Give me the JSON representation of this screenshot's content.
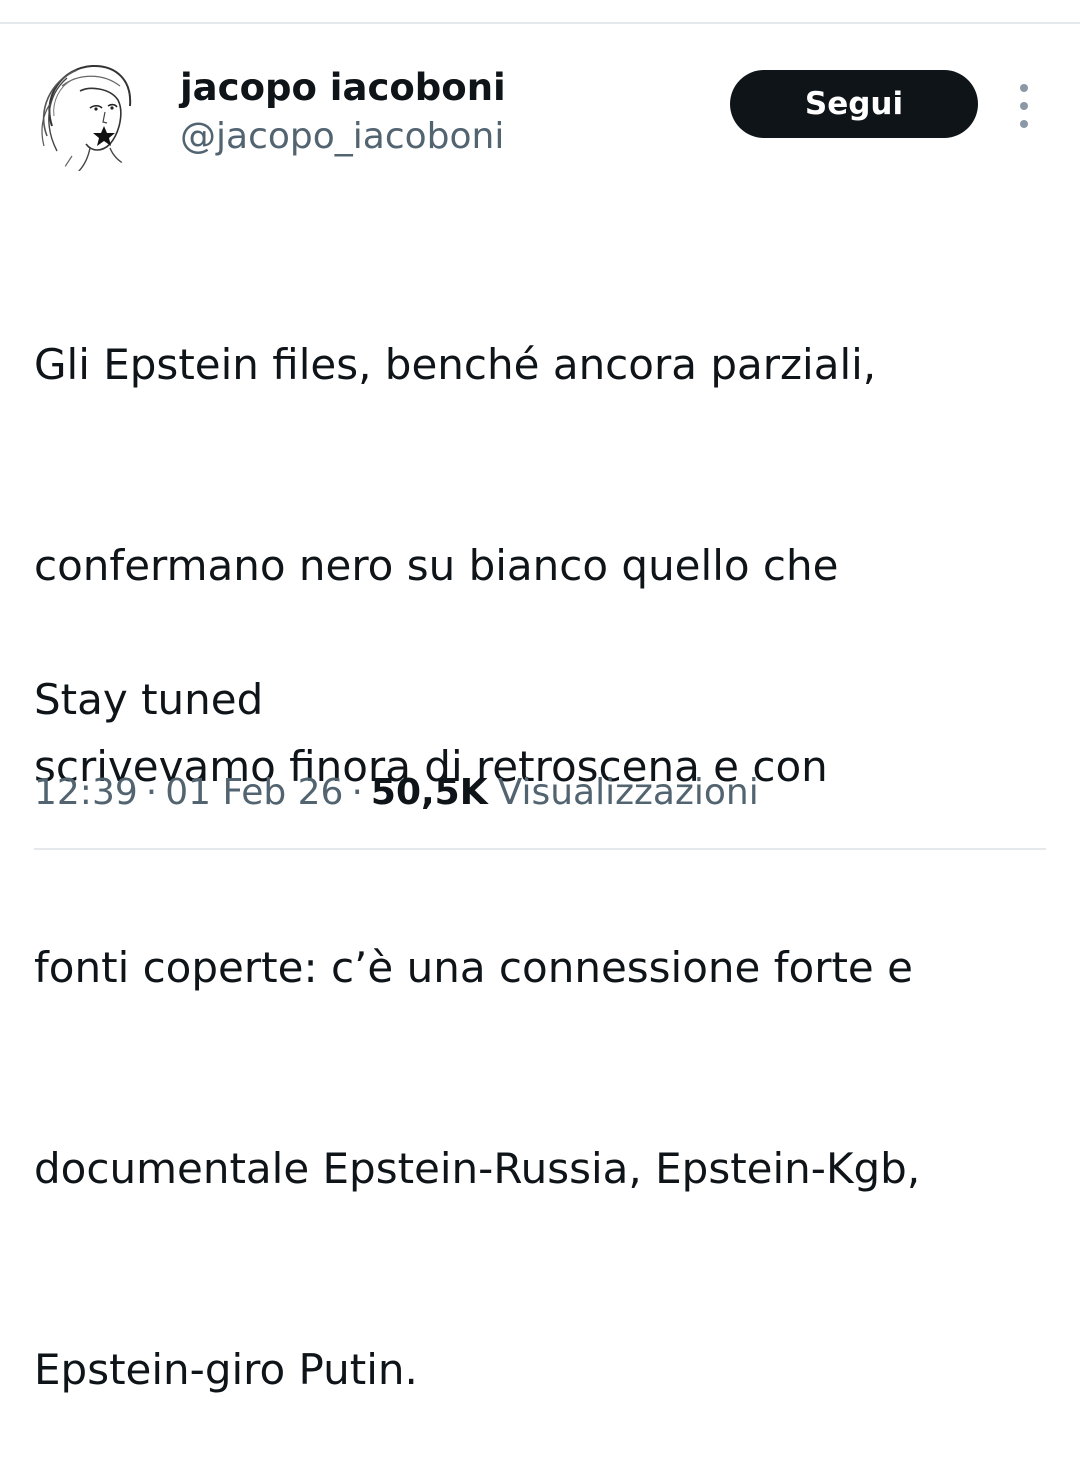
{
  "author": {
    "display_name": "jacopo iacoboni",
    "handle": "@jacopo_iacoboni",
    "avatar_icon": "sketch-portrait-avatar"
  },
  "actions": {
    "follow_label": "Segui",
    "more_icon": "vertical-ellipsis-icon"
  },
  "tweet": {
    "lines": [
      "Gli Epstein files, benché ancora parziali,",
      "confermano nero su bianco quello che",
      "scrivevamo finora di retroscena e con",
      "fonti coperte: c’è una connessione forte e",
      "documentale Epstein-Russia, Epstein-Kgb,",
      "Epstein-giro Putin."
    ],
    "closing": "Stay tuned"
  },
  "meta": {
    "time": "12:39",
    "separator": "·",
    "date": "01 Feb 26",
    "views_count": "50,5K",
    "views_label": "Visualizzazioni"
  },
  "colors": {
    "text_primary": "#0f1419",
    "text_secondary": "#536471",
    "button_bg": "#0f1419",
    "button_text": "#ffffff",
    "divider": "#e6e9eb"
  }
}
